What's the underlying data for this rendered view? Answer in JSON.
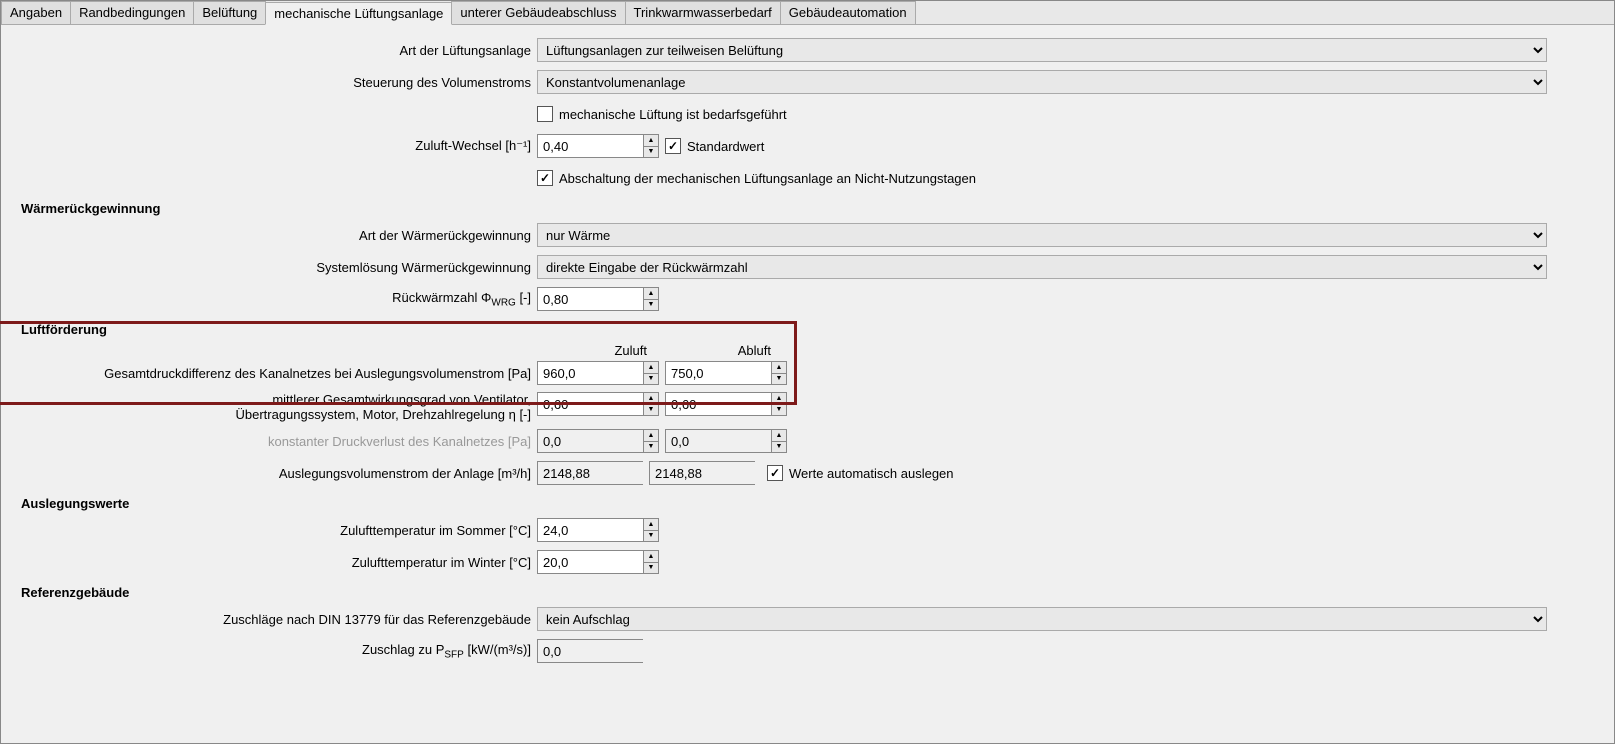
{
  "tabs": [
    "Angaben",
    "Randbedingungen",
    "Belüftung",
    "mechanische Lüftungsanlage",
    "unterer Gebäudeabschluss",
    "Trinkwarmwasserbedarf",
    "Gebäudeautomation"
  ],
  "activeTab": 3,
  "labels": {
    "art_lueftung": "Art der Lüftungsanlage",
    "steuerung": "Steuerung des Volumenstroms",
    "mech_bedarf": "mechanische Lüftung ist bedarfsgeführt",
    "zuluft_wechsel": "Zuluft-Wechsel [h⁻¹]",
    "standardwert": "Standardwert",
    "abschaltung": "Abschaltung der mechanischen Lüftungsanlage an Nicht-Nutzungstagen",
    "sec_wrg": "Wärmerückgewinnung",
    "art_wrg": "Art der Wärmerückgewinnung",
    "systemloesung": "Systemlösung Wärmerückgewinnung",
    "rueckwaermzahl": "Rückwärmzahl Φ",
    "rueckwaermzahl_sub": "WRG",
    "rueckwaermzahl_unit": " [-]",
    "sec_luftfoerderung": "Luftförderung",
    "zuluft_hdr": "Zuluft",
    "abluft_hdr": "Abluft",
    "gesamtdruck": "Gesamtdruckdifferenz des Kanalnetzes bei Auslegungsvolumenstrom [Pa]",
    "wirkungsgrad_line1": "mittlerer Gesamtwirkungsgrad von Ventilator,",
    "wirkungsgrad_line2": "Übertragungssystem, Motor, Drehzahlregelung η [-]",
    "konst_druckverlust": "konstanter Druckverlust des Kanalnetzes [Pa]",
    "auslegungsvolumen": "Auslegungsvolumenstrom der Anlage [m³/h]",
    "werte_auto": "Werte automatisch auslegen",
    "sec_auslegungswerte": "Auslegungswerte",
    "zuluft_sommer": "Zulufttemperatur im Sommer [°C]",
    "zuluft_winter": "Zulufttemperatur im Winter [°C]",
    "sec_referenz": "Referenzgebäude",
    "zuschlaege": "Zuschläge nach DIN 13779 für das Referenzgebäude",
    "zuschlag_psfp": "Zuschlag zu P",
    "zuschlag_psfp_sub": "SFP",
    "zuschlag_psfp_unit": " [kW/(m³/s)]"
  },
  "values": {
    "art_lueftung": "Lüftungsanlagen zur teilweisen Belüftung",
    "steuerung": "Konstantvolumenanlage",
    "mech_bedarf_checked": false,
    "zuluft_wechsel": "0,40",
    "standardwert_checked": true,
    "abschaltung_checked": true,
    "art_wrg": "nur Wärme",
    "systemloesung": "direkte Eingabe der Rückwärmzahl",
    "rueckwaermzahl": "0,80",
    "gesamtdruck_zuluft": "960,0",
    "gesamtdruck_abluft": "750,0",
    "wirkungsgrad_zuluft": "0,60",
    "wirkungsgrad_abluft": "0,60",
    "druckverlust_zuluft": "0,0",
    "druckverlust_abluft": "0,0",
    "auslegungsvolumen_zuluft": "2148,88",
    "auslegungsvolumen_abluft": "2148,88",
    "werte_auto_checked": true,
    "zuluft_sommer": "24,0",
    "zuluft_winter": "20,0",
    "zuschlaege": "kein Aufschlag",
    "zuschlag_psfp": "0,0"
  }
}
